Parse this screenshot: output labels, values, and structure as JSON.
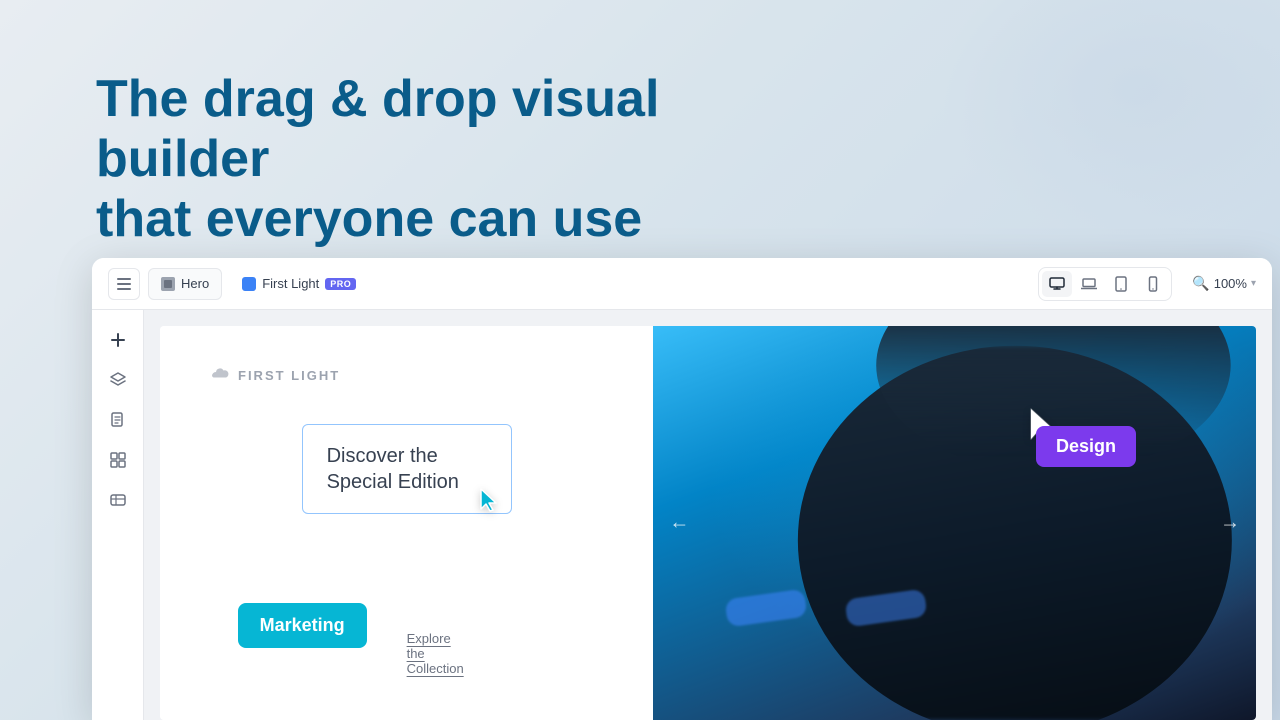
{
  "hero": {
    "title_line1": "The drag & drop visual builder",
    "title_line2": "that everyone can use"
  },
  "toolbar": {
    "menu_label": "menu",
    "tab_hero": "Hero",
    "project_name": "First Light",
    "pro_badge": "PRO",
    "zoom_value": "100%",
    "zoom_label": "zoom"
  },
  "sidebar": {
    "add_label": "+",
    "layers_label": "layers",
    "pages_label": "pages",
    "components_label": "components",
    "media_label": "media"
  },
  "canvas": {
    "brand_name": "FIRST LIGHT",
    "discover_text": "Discover the Special Edition",
    "marketing_badge": "Marketing",
    "design_badge": "Design",
    "explore_link": "Explore the Collection",
    "nav_left": "←",
    "nav_right": "→"
  },
  "viewport_buttons": [
    {
      "label": "desktop",
      "active": true
    },
    {
      "label": "laptop",
      "active": false
    },
    {
      "label": "tablet",
      "active": false
    },
    {
      "label": "mobile",
      "active": false
    }
  ]
}
